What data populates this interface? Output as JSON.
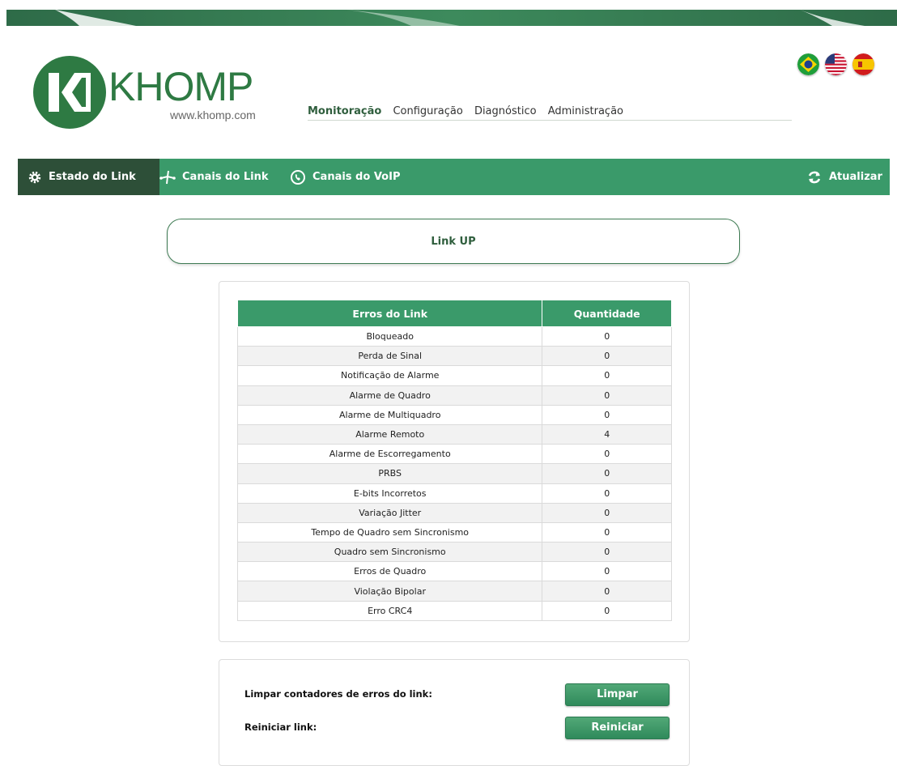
{
  "brand": {
    "name": "KHOMP",
    "url": "www.khomp.com",
    "color": "#2e7a43"
  },
  "languages": [
    {
      "name": "Português (Brasil)",
      "icon": "brazil-flag-icon"
    },
    {
      "name": "English (US)",
      "icon": "us-flag-icon"
    },
    {
      "name": "Español",
      "icon": "spain-flag-icon"
    }
  ],
  "main_nav": {
    "items": [
      "Monitoração",
      "Configuração",
      "Diagnóstico",
      "Administração"
    ],
    "active": "Monitoração"
  },
  "sub_nav": {
    "items": [
      {
        "label": "Estado do Link",
        "icon": "gear-icon",
        "active": true
      },
      {
        "label": "Canais do Link",
        "icon": "network-icon",
        "active": false
      },
      {
        "label": "Canais do VoIP",
        "icon": "phone-circle-icon",
        "active": false
      }
    ],
    "refresh": {
      "label": "Atualizar",
      "icon": "refresh-icon"
    },
    "bar_color": "#3a9a6a",
    "active_color": "#2d4f38"
  },
  "link_status": "Link UP",
  "errors_table": {
    "headers": [
      "Erros do Link",
      "Quantidade"
    ],
    "rows": [
      {
        "name": "Bloqueado",
        "count": "0"
      },
      {
        "name": "Perda de Sinal",
        "count": "0"
      },
      {
        "name": "Notificação de Alarme",
        "count": "0"
      },
      {
        "name": "Alarme de Quadro",
        "count": "0"
      },
      {
        "name": "Alarme de Multiquadro",
        "count": "0"
      },
      {
        "name": "Alarme Remoto",
        "count": "4"
      },
      {
        "name": "Alarme de Escorregamento",
        "count": "0"
      },
      {
        "name": "PRBS",
        "count": "0"
      },
      {
        "name": "E-bits Incorretos",
        "count": "0"
      },
      {
        "name": "Variação Jitter",
        "count": "0"
      },
      {
        "name": "Tempo de Quadro sem Sincronismo",
        "count": "0"
      },
      {
        "name": "Quadro sem Sincronismo",
        "count": "0"
      },
      {
        "name": "Erros de Quadro",
        "count": "0"
      },
      {
        "name": "Violação Bipolar",
        "count": "0"
      },
      {
        "name": "Erro CRC4",
        "count": "0"
      }
    ]
  },
  "actions": {
    "clear_label": "Limpar contadores de erros do link:",
    "clear_button": "Limpar",
    "restart_label": "Reiniciar link:",
    "restart_button": "Reiniciar"
  }
}
